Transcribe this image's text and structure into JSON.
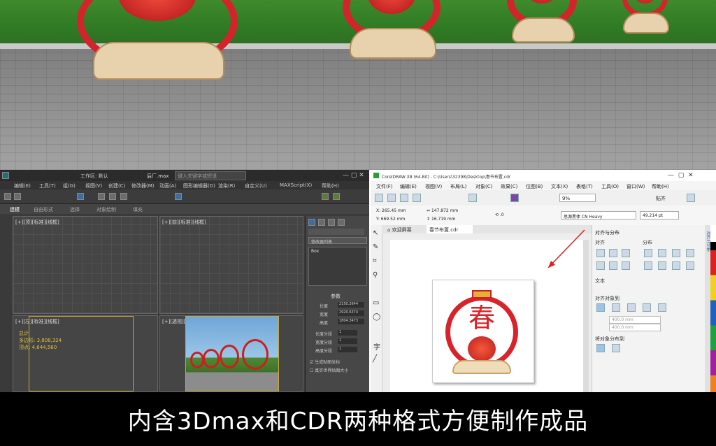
{
  "max": {
    "title": "后厂.max",
    "search_placeholder": "键入关键字或短语",
    "workspace": "工作区: 默认",
    "menu": [
      "编辑(E)",
      "工具(T)",
      "组(G)",
      "视图(V)",
      "创建(C)",
      "修改器(M)",
      "动画(A)",
      "图形编辑器(D)",
      "渲染(R)",
      "自定义(U)",
      "MAXScript(X)",
      "帮助(H)"
    ],
    "tabs": [
      "建模",
      "自由形式",
      "选择",
      "对象绘制",
      "填充"
    ],
    "viewport_labels": [
      "[+][顶][标准][线框]",
      "[+][前][标准][线框]",
      "[+][左][标准][线框]",
      "[+][透视][标准][真实]"
    ],
    "panel": {
      "section": "参数",
      "fields": [
        {
          "label": "长度",
          "value": "2150.2644"
        },
        {
          "label": "宽度",
          "value": "2920.6374"
        },
        {
          "label": "高度",
          "value": "1804.3473"
        },
        {
          "label": "长度分段",
          "value": "1"
        },
        {
          "label": "宽度分段",
          "value": "1"
        },
        {
          "label": "高度分段",
          "value": "1"
        }
      ],
      "check1": "生成贴图坐标",
      "check2": "真实世界贴图大小",
      "object_name": "Box",
      "list_header": "修改器列表"
    },
    "stats": [
      "总计",
      "多边形: 3,808,324",
      "顶点: 4,644,560"
    ]
  },
  "cdr": {
    "title": "CorelDRAW X8 (64-Bit) - C:\\Users\\32398\\Desktop\\春节布置.cdr",
    "menu": [
      "文件(F)",
      "编辑(E)",
      "视图(V)",
      "布局(L)",
      "对象(C)",
      "效果(C)",
      "位图(B)",
      "文本(X)",
      "表格(T)",
      "工具(O)",
      "窗口(W)",
      "帮助(H)"
    ],
    "zoom": "9%",
    "snap": "贴齐",
    "x": "265.45 mm",
    "y": "669.52 mm",
    "w": "147.872 mm",
    "h": "16.719 mm",
    "angle": ".0",
    "font": "思源黑体 CN Heavy",
    "font_size": "49.214 pt",
    "tabs": [
      "欢迎屏幕",
      "春节布置.cdr"
    ],
    "panel_title": "对齐与分布",
    "align_label": "对齐",
    "distribute_label": "分布",
    "text_label": "文本",
    "align_to_label": "对齐对象到",
    "x_field": "400.0 mm",
    "y_field": "400.0 mm",
    "distribute_to_label": "将对象分布到",
    "side_tab": "对齐与分布",
    "artwork_char": "春"
  },
  "caption": "内含3Dmax和CDR两种格式方便制作成品"
}
